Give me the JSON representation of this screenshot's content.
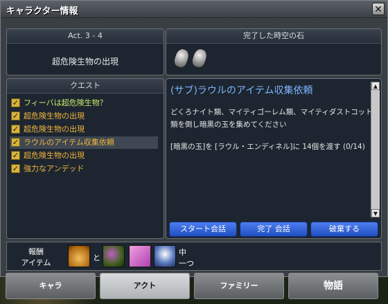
{
  "window": {
    "title": "キャラクター情報"
  },
  "act_panel": {
    "header": "Act. 3 - 4",
    "subtitle": "超危険生物の出現"
  },
  "stone_panel": {
    "header": "完了した時空の石",
    "stone_count": 2
  },
  "quest_panel": {
    "header": "クエスト",
    "items": [
      {
        "label": "フィーバは超危険生物？",
        "checked": true,
        "color": "#c8e86a"
      },
      {
        "label": "超危険生物の出現",
        "checked": true,
        "color": "#f0b43c"
      },
      {
        "label": "超危険生物の出現",
        "checked": true,
        "color": "#f0b43c"
      },
      {
        "label": "ラウルのアイテム収集依頼",
        "checked": true,
        "color": "#f0b43c",
        "selected": true
      },
      {
        "label": "超危険生物の出現",
        "checked": true,
        "color": "#f0b43c"
      },
      {
        "label": "強力なアンデッド",
        "checked": true,
        "color": "#f0b43c"
      }
    ]
  },
  "detail": {
    "title": "(サブ)ラウルのアイテム収集依頼",
    "line1": "どくろナイト類、マイティゴーレム類、マイティダストコット",
    "line2": "類を倒し暗黒の玉を集めてください",
    "line3": "[暗黒の玉]を [ラウル・エンディネル]に 14個を渡す (0/14)"
  },
  "buttons": {
    "start": "スタート会話",
    "complete": "完了 会話",
    "abandon": "破棄する"
  },
  "reward": {
    "label_top": "報酬",
    "label_bottom": "アイテム",
    "and_text": "と",
    "text_top": "中",
    "text_bottom": "一つ",
    "icons": [
      "gold-bag-icon",
      "herb-bundle-icon",
      "pink-leaf-icon",
      "potion-jar-icon"
    ]
  },
  "tabs": [
    {
      "label": "キャラ",
      "active": false
    },
    {
      "label": "アクト",
      "active": true
    },
    {
      "label": "ファミリー",
      "active": false
    },
    {
      "label": "物語",
      "active": false
    }
  ]
}
